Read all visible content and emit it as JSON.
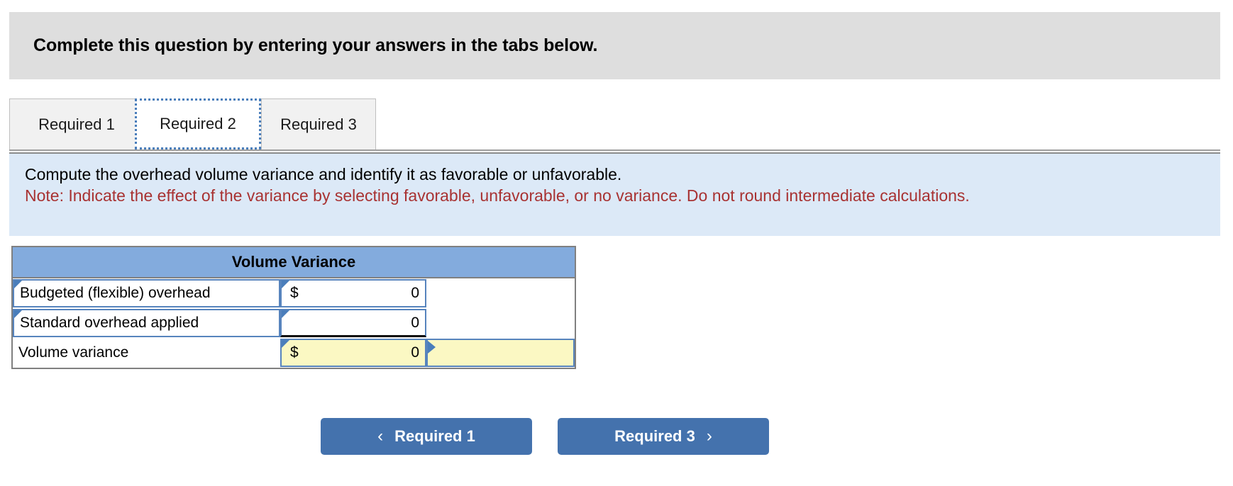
{
  "banner": {
    "text": "Complete this question by entering your answers in the tabs below."
  },
  "tabs": {
    "items": [
      {
        "label": "Required 1",
        "active": false
      },
      {
        "label": "Required 2",
        "active": true
      },
      {
        "label": "Required 3",
        "active": false
      }
    ]
  },
  "instructions": {
    "prompt": "Compute the overhead volume variance and identify it as favorable or unfavorable.",
    "note": "Note: Indicate the effect of the variance by selecting favorable, unfavorable, or no variance. Do not round intermediate calculations."
  },
  "table": {
    "title": "Volume Variance",
    "rows": [
      {
        "label": "Budgeted (flexible) overhead",
        "currency": "$",
        "value": "0",
        "effect": ""
      },
      {
        "label": "Standard overhead applied",
        "currency": "",
        "value": "0",
        "effect": ""
      },
      {
        "label": "Volume variance",
        "currency": "$",
        "value": "0",
        "effect": ""
      }
    ]
  },
  "footer": {
    "prev_label": "Required 1",
    "next_label": "Required 3",
    "prev_icon": "chevron-left",
    "next_icon": "chevron-right",
    "prev_glyph": "‹",
    "next_glyph": "›"
  },
  "colors": {
    "banner_bg": "#dedede",
    "instruction_bg": "#dce9f7",
    "note_text": "#a83232",
    "table_header_bg": "#83abdd",
    "cell_border": "#5784bd",
    "highlight_bg": "#fbf8c3",
    "button_bg": "#4472ad",
    "active_tab_focus": "#4a7ebb"
  }
}
